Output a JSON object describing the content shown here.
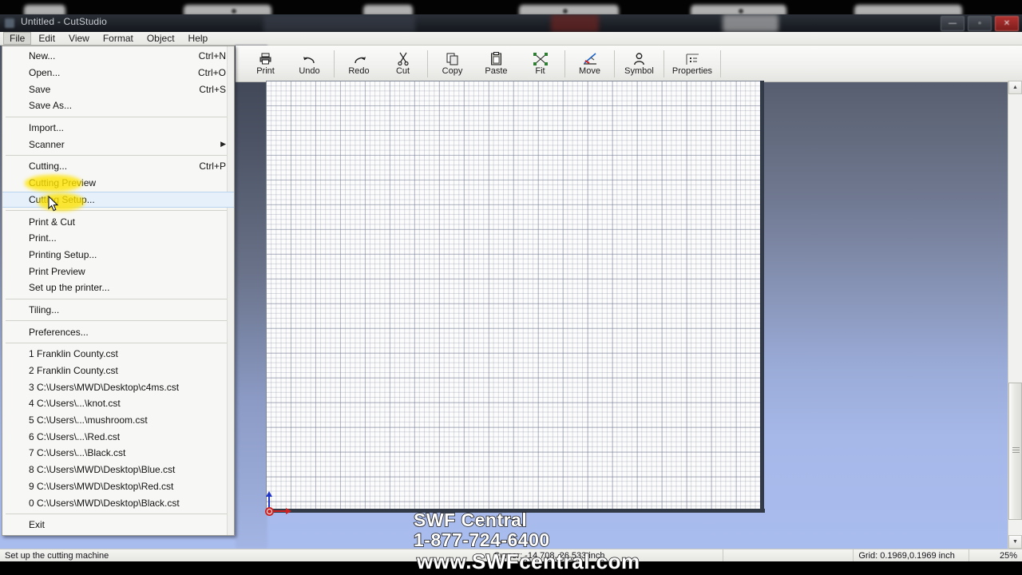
{
  "window": {
    "title": "Untitled - CutStudio",
    "buttons": {
      "minimize": "—",
      "maximize": "▫",
      "close": "✕"
    }
  },
  "menubar": {
    "items": [
      {
        "label": "File",
        "active": true
      },
      {
        "label": "Edit",
        "active": false
      },
      {
        "label": "View",
        "active": false
      },
      {
        "label": "Format",
        "active": false
      },
      {
        "label": "Object",
        "active": false
      },
      {
        "label": "Help",
        "active": false
      }
    ]
  },
  "toolbar": {
    "buttons": [
      {
        "label": "Print",
        "icon": "printer-icon"
      },
      {
        "label": "Undo",
        "icon": "undo-arrow-icon"
      },
      {
        "label": "Redo",
        "icon": "redo-arrow-icon"
      },
      {
        "label": "Cut",
        "icon": "scissors-icon"
      },
      {
        "label": "Copy",
        "icon": "copy-pages-icon"
      },
      {
        "label": "Paste",
        "icon": "clipboard-icon"
      },
      {
        "label": "Fit",
        "icon": "fit-corners-icon"
      },
      {
        "label": "Move",
        "icon": "move-blade-icon"
      },
      {
        "label": "Symbol",
        "icon": "person-symbol-icon"
      },
      {
        "label": "Properties",
        "icon": "properties-panel-icon"
      }
    ]
  },
  "file_menu": {
    "groups": [
      [
        {
          "label": "New...",
          "accel": "Ctrl+N"
        },
        {
          "label": "Open...",
          "accel": "Ctrl+O"
        },
        {
          "label": "Save",
          "accel": "Ctrl+S"
        },
        {
          "label": "Save As...",
          "accel": ""
        }
      ],
      [
        {
          "label": "Import...",
          "accel": ""
        },
        {
          "label": "Scanner",
          "accel": "",
          "submenu": "▶"
        }
      ],
      [
        {
          "label": "Cutting...",
          "accel": "Ctrl+P"
        },
        {
          "label": "Cutting Preview",
          "accel": ""
        },
        {
          "label": "Cutting Setup...",
          "accel": "",
          "selected": true
        }
      ],
      [
        {
          "label": "Print & Cut",
          "accel": ""
        },
        {
          "label": "Print...",
          "accel": ""
        },
        {
          "label": "Printing Setup...",
          "accel": ""
        },
        {
          "label": "Print Preview",
          "accel": ""
        },
        {
          "label": "Set up the printer...",
          "accel": ""
        }
      ],
      [
        {
          "label": "Tiling...",
          "accel": ""
        }
      ],
      [
        {
          "label": "Preferences...",
          "accel": ""
        }
      ],
      [
        {
          "label": "1 Franklin County.cst",
          "accel": ""
        },
        {
          "label": "2 Franklin County.cst",
          "accel": ""
        },
        {
          "label": "3 C:\\Users\\MWD\\Desktop\\c4ms.cst",
          "accel": ""
        },
        {
          "label": "4 C:\\Users\\...\\knot.cst",
          "accel": ""
        },
        {
          "label": "5 C:\\Users\\...\\mushroom.cst",
          "accel": ""
        },
        {
          "label": "6 C:\\Users\\...\\Red.cst",
          "accel": ""
        },
        {
          "label": "7 C:\\Users\\...\\Black.cst",
          "accel": ""
        },
        {
          "label": "8 C:\\Users\\MWD\\Desktop\\Blue.cst",
          "accel": ""
        },
        {
          "label": "9 C:\\Users\\MWD\\Desktop\\Red.cst",
          "accel": ""
        },
        {
          "label": "0 C:\\Users\\MWD\\Desktop\\Black.cst",
          "accel": ""
        }
      ],
      [
        {
          "label": "Exit",
          "accel": ""
        }
      ]
    ]
  },
  "statusbar": {
    "message": "Set up the cutting machine",
    "cursor": "Cursor: -14.708, 26.533 inch",
    "blank": "",
    "grid": "Grid: 0.1969,0.1969 inch",
    "zoom": "25%"
  },
  "watermark": {
    "line1": "SWF Central",
    "line2": "1-877-724-6400",
    "line3": "www.SWFcentral.com"
  },
  "colors": {
    "highlight_yellow": "#ffe400",
    "menu_selection": "#e6f0fb",
    "close_button_red": "#b03230",
    "origin_x_axis": "#cc2222",
    "origin_y_axis": "#2036c8",
    "canvas_white": "#fcfcfc",
    "background_top": "#4c5465",
    "background_bottom": "#a9bcee"
  }
}
